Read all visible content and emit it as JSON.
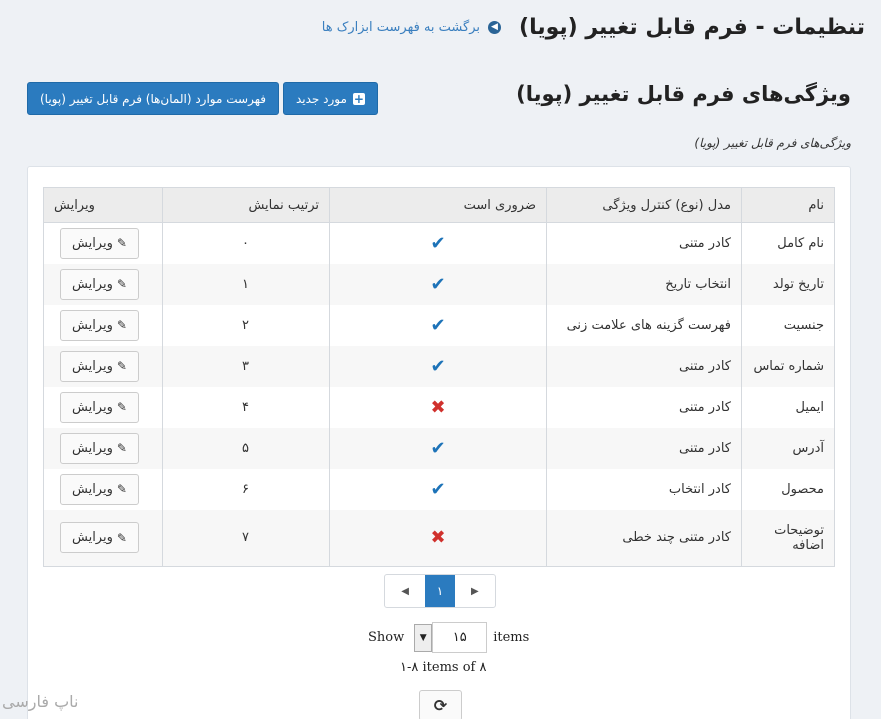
{
  "header": {
    "title": "تنظیمات - فرم قابل تغییر (پویا)",
    "back_link": "برگشت به فهرست ابزارک ها",
    "back_icon": "arrow-circle-left-icon"
  },
  "section": {
    "title": "ویژگی‌های فرم قابل تغییر (پویا)",
    "subtitle": "ویژگی‌های فرم قابل تغییر (پویا)"
  },
  "toolbar": {
    "new_label": "مورد جدید",
    "list_label": "فهرست موارد (المان‌ها) فرم قابل تغییر (پویا)"
  },
  "table": {
    "headers": {
      "name": "نام",
      "model": "مدل (نوع) کنترل ویژگی",
      "required": "ضروری است",
      "order": "ترتیب نمایش",
      "edit": "ویرایش"
    },
    "edit_label": "ویرایش",
    "rows": [
      {
        "name": "نام کامل",
        "model": "کادر متنی",
        "required": true,
        "order": "۰"
      },
      {
        "name": "تاریخ تولد",
        "model": "انتخاب تاریخ",
        "required": true,
        "order": "۱"
      },
      {
        "name": "جنسیت",
        "model": "فهرست گزینه های علامت زنی",
        "required": true,
        "order": "۲"
      },
      {
        "name": "شماره تماس",
        "model": "کادر متنی",
        "required": true,
        "order": "۳"
      },
      {
        "name": "ایمیل",
        "model": "کادر متنی",
        "required": false,
        "order": "۴"
      },
      {
        "name": "آدرس",
        "model": "کادر متنی",
        "required": true,
        "order": "۵"
      },
      {
        "name": "محصول",
        "model": "کادر انتخاب",
        "required": true,
        "order": "۶"
      },
      {
        "name": "توضیحات اضافه",
        "model": "کادر متنی چند خطی",
        "required": false,
        "order": "۷"
      }
    ]
  },
  "pager": {
    "current_page": "۱",
    "show_label": "Show",
    "page_size": "۱۵",
    "items_label": "items",
    "range_text": "۱-۸ items of ۸"
  },
  "watermark": "ناپ فارسی",
  "colors": {
    "primary": "#2b7bbf",
    "check": "#1d73b8",
    "cross": "#d0312d"
  }
}
